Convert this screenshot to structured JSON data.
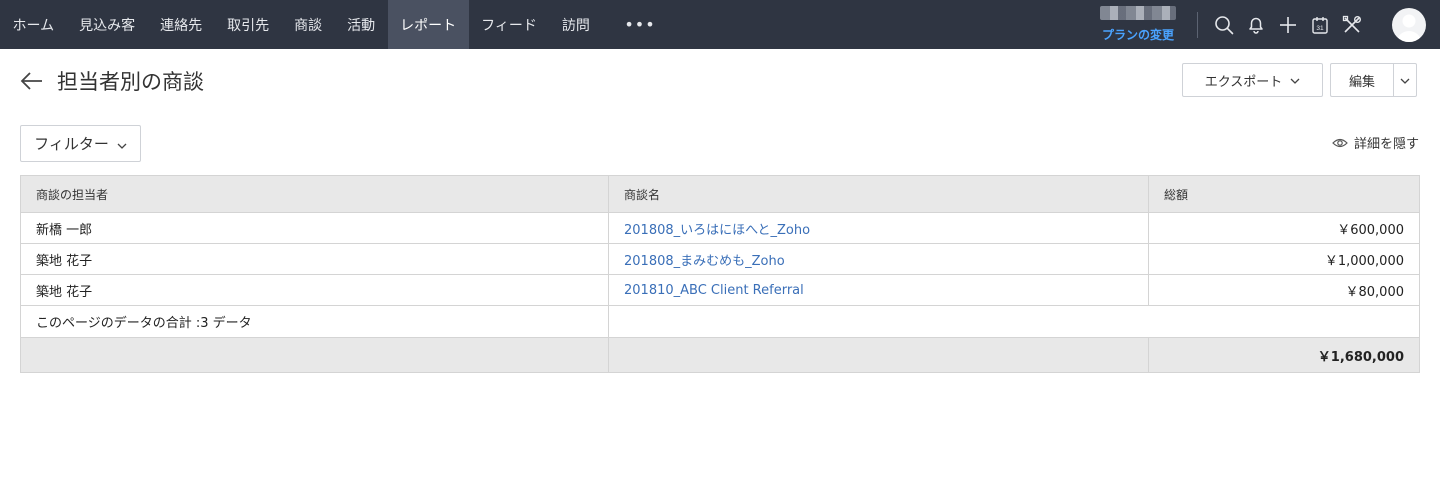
{
  "nav": {
    "items": [
      {
        "label": "ホーム"
      },
      {
        "label": "見込み客"
      },
      {
        "label": "連絡先"
      },
      {
        "label": "取引先"
      },
      {
        "label": "商談"
      },
      {
        "label": "活動"
      },
      {
        "label": "レポート",
        "active": true
      },
      {
        "label": "フィード"
      },
      {
        "label": "訪問"
      }
    ],
    "more_label": "•••",
    "plan_link": "プランの変更",
    "icons": [
      "search-icon",
      "bell-icon",
      "plus-icon",
      "calendar-icon",
      "tools-icon",
      "avatar"
    ],
    "calendar_day": "31"
  },
  "header": {
    "title": "担当者別の商談",
    "export_label": "エクスポート",
    "edit_label": "編集",
    "filter_label": "フィルター",
    "hide_details_label": "詳細を隠す"
  },
  "table": {
    "columns": [
      "商談の担当者",
      "商談名",
      "総額"
    ],
    "rows": [
      {
        "owner": "新橋 一郎",
        "deal": "201808_いろはにほへと_Zoho",
        "amount": "￥600,000"
      },
      {
        "owner": "築地 花子",
        "deal": "201808_まみむめも_Zoho",
        "amount": "￥1,000,000"
      },
      {
        "owner": "築地 花子",
        "deal": "201810_ABC Client Referral",
        "amount": "￥80,000"
      }
    ],
    "summary_label": "このページのデータの合計 :3 データ",
    "total_amount": "￥1,680,000"
  },
  "colors": {
    "nav_bg": "#2f3542",
    "nav_active_bg": "#4a5161",
    "link": "#3a6fb8",
    "plan_link": "#4aa3ff",
    "header_bg": "#e8e8e8"
  }
}
